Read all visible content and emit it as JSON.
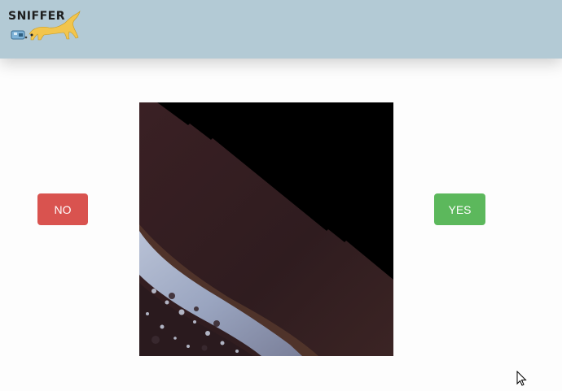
{
  "header": {
    "logo_text": "SNIFFER",
    "background": "#b3cad5"
  },
  "main": {
    "no_button_label": "NO",
    "yes_button_label": "YES",
    "no_color": "#d9534f",
    "yes_color": "#5cb85c",
    "image_kind": "satellite-tile"
  },
  "icons": {
    "dog": "dog-icon",
    "cursor": "mouse-cursor-icon"
  }
}
